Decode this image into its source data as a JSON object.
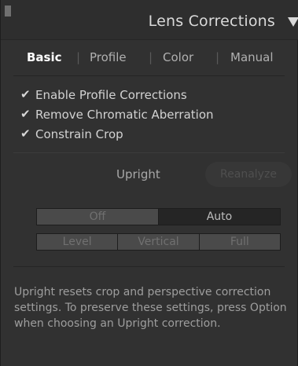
{
  "header": {
    "title": "Lens Corrections"
  },
  "tabs": [
    {
      "label": "Basic",
      "active": true
    },
    {
      "label": "Profile",
      "active": false
    },
    {
      "label": "Color",
      "active": false
    },
    {
      "label": "Manual",
      "active": false
    }
  ],
  "tab_separator": "|",
  "checkboxes": [
    {
      "label": "Enable Profile Corrections",
      "checked": true
    },
    {
      "label": "Remove Chromatic Aberration",
      "checked": true
    },
    {
      "label": "Constrain Crop",
      "checked": true
    }
  ],
  "check_glyph": "✔",
  "upright": {
    "label": "Upright",
    "reanalyze_label": "Reanalyze"
  },
  "upright_modes_row1": [
    {
      "label": "Off",
      "selected": false
    },
    {
      "label": "Auto",
      "selected": true
    }
  ],
  "upright_modes_row2": [
    {
      "label": "Level",
      "selected": false
    },
    {
      "label": "Vertical",
      "selected": false
    },
    {
      "label": "Full",
      "selected": false
    }
  ],
  "help_text": "Upright resets crop and perspective correction settings. To preserve these settings, press Option when choosing an Upright correction.",
  "colors": {
    "panel_bg": "#313131",
    "text": "#d2d2d2",
    "active_tab": "#ffffff"
  },
  "icons": {
    "collapse": "triangle-down-icon",
    "check": "checkmark-icon"
  }
}
